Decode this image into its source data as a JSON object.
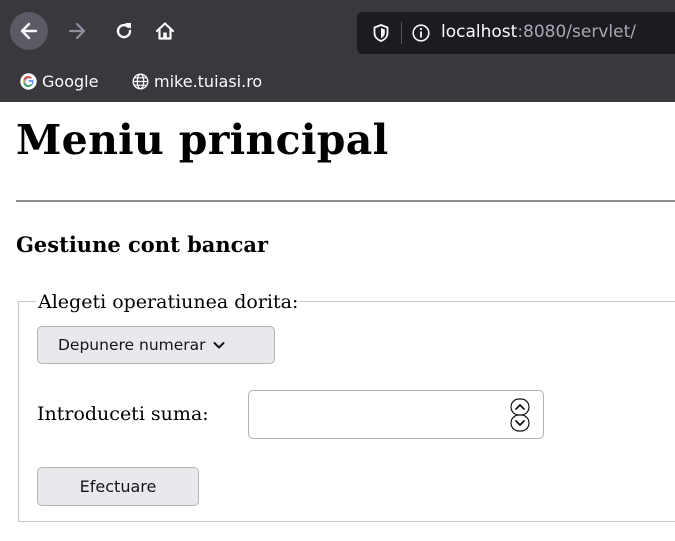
{
  "browser": {
    "url_host": "localhost",
    "url_rest": ":8080/servlet/",
    "bookmarks": [
      {
        "label": "Google",
        "icon": "google-icon"
      },
      {
        "label": "mike.tuiasi.ro",
        "icon": "globe-icon"
      }
    ],
    "icons": [
      "back-arrow-icon",
      "forward-arrow-icon",
      "reload-icon",
      "home-icon",
      "shield-icon",
      "info-icon"
    ]
  },
  "page": {
    "title": "Meniu principal",
    "section_title": "Gestiune cont bancar",
    "form": {
      "legend": "Alegeti operatiunea dorita:",
      "operation_selected": "Depunere numerar",
      "amount_label": "Introduceti suma:",
      "amount_value": "",
      "submit_label": "Efectuare"
    }
  },
  "colors": {
    "chrome_bg": "#38383d",
    "urlbar_bg": "#1c1b22",
    "button_bg": "#e9e9ed"
  }
}
